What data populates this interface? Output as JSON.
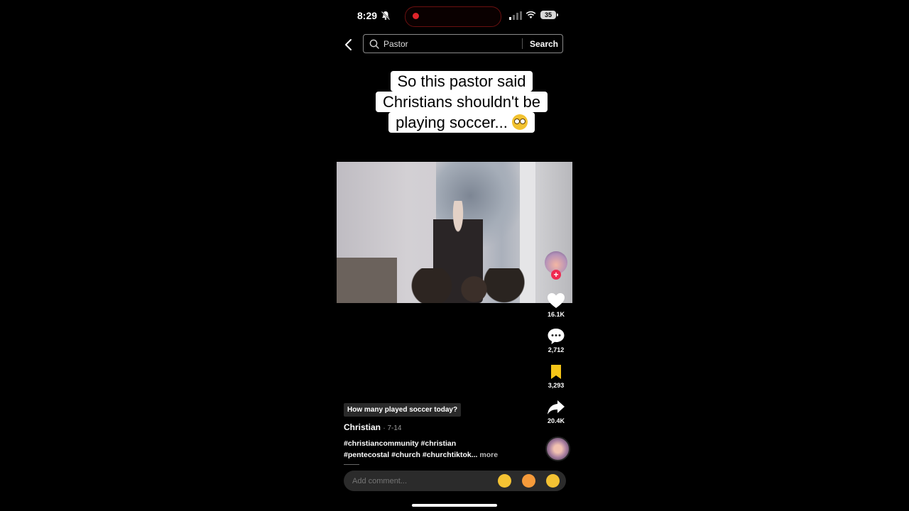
{
  "status_bar": {
    "time": "8:29",
    "battery": "35"
  },
  "search": {
    "value": "Pastor",
    "button_label": "Search"
  },
  "caption": {
    "lines": [
      "So this pastor said",
      "Christians shouldn't be",
      "playing soccer..."
    ]
  },
  "actions": {
    "likes": "16.1K",
    "comments": "2,712",
    "saves": "3,293",
    "shares": "20.4K"
  },
  "post": {
    "prompt": "How many played soccer today?",
    "author": "Christian",
    "date": "· 7-14",
    "hashtags_line1": "#christiancommunity #christian",
    "hashtags_line2": "#pentecostal #church #churchtiktok...",
    "more_label": "more"
  },
  "comment": {
    "placeholder": "Add comment..."
  },
  "colors": {
    "accent": "#ef2950",
    "bookmark": "#f5c518",
    "background": "#000000"
  }
}
